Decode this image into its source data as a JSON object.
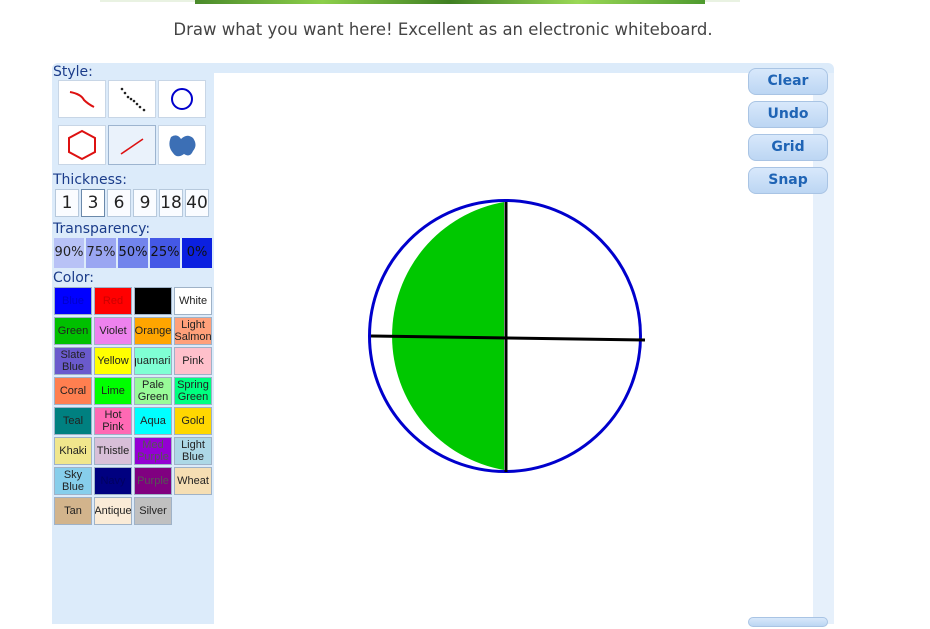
{
  "instructions": "Draw what you want here! Excellent as an electronic whiteboard.",
  "labels": {
    "style": "Style:",
    "thickness": "Thickness:",
    "transparency": "Transparency:",
    "color": "Color:"
  },
  "style_tools": [
    {
      "name": "freehand-line",
      "icon": "curve-icon"
    },
    {
      "name": "dotted-line",
      "icon": "dots-icon"
    },
    {
      "name": "circle",
      "icon": "circle-icon"
    },
    {
      "name": "polygon",
      "icon": "hexagon-icon"
    },
    {
      "name": "straight-line",
      "icon": "line-icon",
      "selected": true
    },
    {
      "name": "filled-blob",
      "icon": "blob-icon"
    }
  ],
  "thickness": {
    "options": [
      "1",
      "3",
      "6",
      "9",
      "18",
      "40"
    ],
    "selected": "3"
  },
  "transparency": {
    "options": [
      "90%",
      "75%",
      "50%",
      "25%",
      "0%"
    ],
    "selected": "0%"
  },
  "colors": [
    {
      "label": "Blue",
      "hex": "#0000ff",
      "text": "#0000cc"
    },
    {
      "label": "Red",
      "hex": "#ff0000",
      "text": "#cc0000"
    },
    {
      "label": "",
      "hex": "#000000",
      "text": "#000000"
    },
    {
      "label": "White",
      "hex": "#ffffff",
      "text": "#222222"
    },
    {
      "label": "Green",
      "hex": "#00c000",
      "text": "#222222"
    },
    {
      "label": "Violet",
      "hex": "#ee82ee",
      "text": "#222222"
    },
    {
      "label": "Orange",
      "hex": "#ffa500",
      "text": "#222222"
    },
    {
      "label": "Light Salmon",
      "hex": "#ffa07a",
      "text": "#222222"
    },
    {
      "label": "Slate Blue",
      "hex": "#6a5acd",
      "text": "#222222"
    },
    {
      "label": "Yellow",
      "hex": "#ffff00",
      "text": "#222222"
    },
    {
      "label": "Aquamarine",
      "hex": "#7fffd4",
      "text": "#222222"
    },
    {
      "label": "Pink",
      "hex": "#ffc0cb",
      "text": "#222222"
    },
    {
      "label": "Coral",
      "hex": "#ff7f50",
      "text": "#222222"
    },
    {
      "label": "Lime",
      "hex": "#00ff00",
      "text": "#222222"
    },
    {
      "label": "Pale Green",
      "hex": "#98fb98",
      "text": "#222222"
    },
    {
      "label": "Spring Green",
      "hex": "#00ff7f",
      "text": "#222222"
    },
    {
      "label": "Teal",
      "hex": "#008080",
      "text": "#222222"
    },
    {
      "label": "Hot Pink",
      "hex": "#ff69b4",
      "text": "#222222"
    },
    {
      "label": "Aqua",
      "hex": "#00ffff",
      "text": "#222222"
    },
    {
      "label": "Gold",
      "hex": "#ffd700",
      "text": "#222222"
    },
    {
      "label": "Khaki",
      "hex": "#f0e68c",
      "text": "#222222"
    },
    {
      "label": "Thistle",
      "hex": "#d8bfd8",
      "text": "#222222"
    },
    {
      "label": "Med Purple",
      "hex": "#9400d3",
      "text": "#555555"
    },
    {
      "label": "Light Blue",
      "hex": "#add8e6",
      "text": "#222222"
    },
    {
      "label": "Sky Blue",
      "hex": "#87ceeb",
      "text": "#222222"
    },
    {
      "label": "Navy",
      "hex": "#000080",
      "text": "#000060"
    },
    {
      "label": "Purple",
      "hex": "#800080",
      "text": "#555555"
    },
    {
      "label": "Wheat",
      "hex": "#f5deb3",
      "text": "#222222"
    },
    {
      "label": "Tan",
      "hex": "#d2b48c",
      "text": "#222222"
    },
    {
      "label": "Antique",
      "hex": "#faebd7",
      "text": "#222222"
    },
    {
      "label": "Silver",
      "hex": "#c0c0c0",
      "text": "#222222"
    }
  ],
  "side_buttons": {
    "clear": "Clear",
    "undo": "Undo",
    "grid": "Grid",
    "snap": "Snap"
  },
  "drawing": {
    "fill_color": "#00c800",
    "circle_stroke": "#0000cc",
    "line_color": "#000000"
  }
}
